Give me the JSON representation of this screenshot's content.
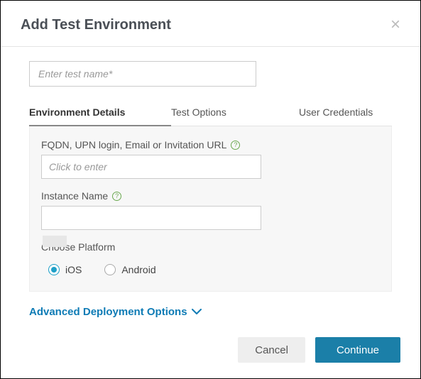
{
  "header": {
    "title": "Add Test Environment"
  },
  "form": {
    "name_placeholder": "Enter test name*"
  },
  "tabs": [
    {
      "label": "Environment Details",
      "active": true
    },
    {
      "label": "Test Options",
      "active": false
    },
    {
      "label": "User Credentials",
      "active": false
    }
  ],
  "panel": {
    "fqdn_label": "FQDN, UPN login, Email or Invitation URL",
    "fqdn_placeholder": "Click to enter",
    "instance_label": "Instance Name",
    "platform_label": "Choose Platform",
    "platforms": {
      "ios": "iOS",
      "android": "Android",
      "selected": "ios"
    }
  },
  "advanced_label": "Advanced Deployment Options",
  "buttons": {
    "cancel": "Cancel",
    "continue": "Continue"
  }
}
